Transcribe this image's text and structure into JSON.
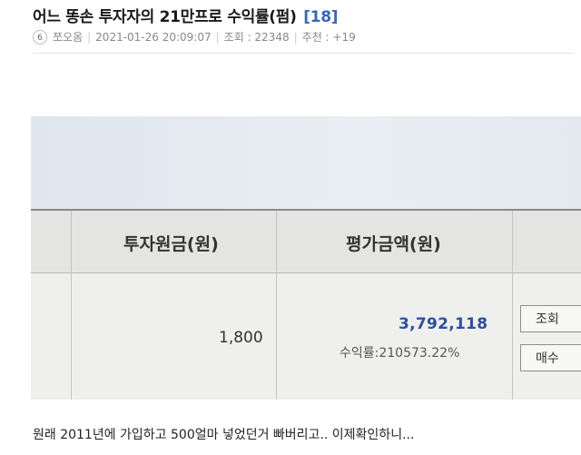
{
  "post": {
    "title": "어느 똥손 투자자의 21만프로 수익률(펌)",
    "comment_count": "[18]",
    "level": "6",
    "author": "쪼오옴",
    "date": "2021-01-26 20:09:07",
    "views": "조회 : 22348",
    "recommends": "추천 : +19",
    "caption": "원래 2011년에 가입하고 500얼마 넣었던거 빠버리고.. 이제확인하니..."
  },
  "photo": {
    "table": {
      "headers": [
        "투자원금(원)",
        "평가금액(원)"
      ],
      "principal": "1,800",
      "valuation": "3,792,118",
      "return_rate": "수익률:210573.22%"
    },
    "buttons": {
      "query": "조회",
      "buy": "매수"
    }
  }
}
